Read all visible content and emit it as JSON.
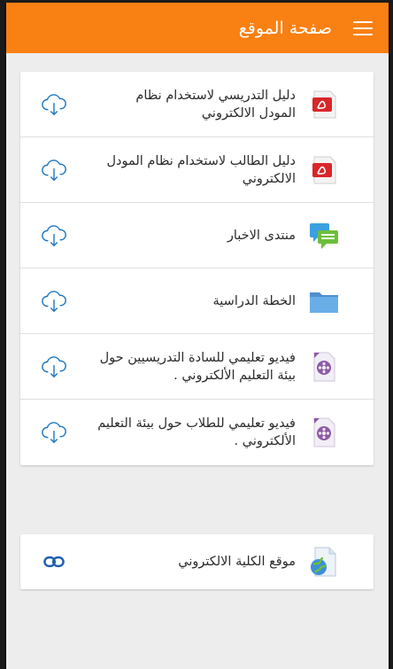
{
  "header": {
    "title": "صفحة الموقع",
    "menu_icon": "hamburger-menu-icon",
    "color": "#f98012"
  },
  "resources": [
    {
      "label": "دليل التدريسي لاستخدام نظام المودل الالكتروني",
      "type_icon": "pdf-icon",
      "action_icon": "cloud-download-icon"
    },
    {
      "label": "دليل الطالب لاستخدام نظام المودل الالكتروني",
      "type_icon": "pdf-icon",
      "action_icon": "cloud-download-icon"
    },
    {
      "label": "منتدى الاخبار",
      "type_icon": "forum-icon",
      "action_icon": "cloud-download-icon"
    },
    {
      "label": "الخطة الدراسية",
      "type_icon": "folder-icon",
      "action_icon": "cloud-download-icon"
    },
    {
      "label": "فيديو تعليمي للسادة التدريسيين حول بيئة التعليم الألكتروني .",
      "type_icon": "video-icon",
      "action_icon": "cloud-download-icon"
    },
    {
      "label": "فيديو تعليمي للطلاب حول بيئة التعليم الألكتروني .",
      "type_icon": "video-icon",
      "action_icon": "cloud-download-icon"
    }
  ],
  "links": [
    {
      "label": "موقع الكلية الالكتروني",
      "type_icon": "url-globe-icon",
      "action_icon": "link-icon"
    }
  ],
  "colors": {
    "accent": "#f98012",
    "action_blue": "#1f78c1",
    "pdf_red": "#d9262a",
    "forum_blue": "#3aa0e0",
    "forum_green": "#6dbe3c",
    "folder_blue": "#6aaee8",
    "video_purple": "#8e5aa8"
  }
}
